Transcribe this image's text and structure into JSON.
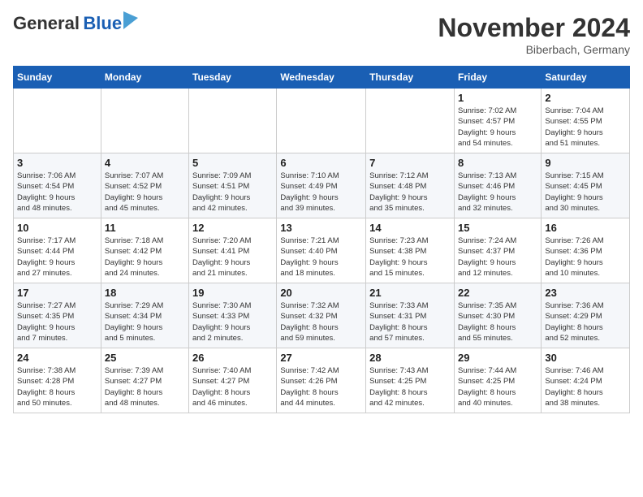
{
  "header": {
    "logo_line1": "General",
    "logo_line2": "Blue",
    "month": "November 2024",
    "location": "Biberbach, Germany"
  },
  "weekdays": [
    "Sunday",
    "Monday",
    "Tuesday",
    "Wednesday",
    "Thursday",
    "Friday",
    "Saturday"
  ],
  "weeks": [
    [
      {
        "day": "",
        "info": ""
      },
      {
        "day": "",
        "info": ""
      },
      {
        "day": "",
        "info": ""
      },
      {
        "day": "",
        "info": ""
      },
      {
        "day": "",
        "info": ""
      },
      {
        "day": "1",
        "info": "Sunrise: 7:02 AM\nSunset: 4:57 PM\nDaylight: 9 hours\nand 54 minutes."
      },
      {
        "day": "2",
        "info": "Sunrise: 7:04 AM\nSunset: 4:55 PM\nDaylight: 9 hours\nand 51 minutes."
      }
    ],
    [
      {
        "day": "3",
        "info": "Sunrise: 7:06 AM\nSunset: 4:54 PM\nDaylight: 9 hours\nand 48 minutes."
      },
      {
        "day": "4",
        "info": "Sunrise: 7:07 AM\nSunset: 4:52 PM\nDaylight: 9 hours\nand 45 minutes."
      },
      {
        "day": "5",
        "info": "Sunrise: 7:09 AM\nSunset: 4:51 PM\nDaylight: 9 hours\nand 42 minutes."
      },
      {
        "day": "6",
        "info": "Sunrise: 7:10 AM\nSunset: 4:49 PM\nDaylight: 9 hours\nand 39 minutes."
      },
      {
        "day": "7",
        "info": "Sunrise: 7:12 AM\nSunset: 4:48 PM\nDaylight: 9 hours\nand 35 minutes."
      },
      {
        "day": "8",
        "info": "Sunrise: 7:13 AM\nSunset: 4:46 PM\nDaylight: 9 hours\nand 32 minutes."
      },
      {
        "day": "9",
        "info": "Sunrise: 7:15 AM\nSunset: 4:45 PM\nDaylight: 9 hours\nand 30 minutes."
      }
    ],
    [
      {
        "day": "10",
        "info": "Sunrise: 7:17 AM\nSunset: 4:44 PM\nDaylight: 9 hours\nand 27 minutes."
      },
      {
        "day": "11",
        "info": "Sunrise: 7:18 AM\nSunset: 4:42 PM\nDaylight: 9 hours\nand 24 minutes."
      },
      {
        "day": "12",
        "info": "Sunrise: 7:20 AM\nSunset: 4:41 PM\nDaylight: 9 hours\nand 21 minutes."
      },
      {
        "day": "13",
        "info": "Sunrise: 7:21 AM\nSunset: 4:40 PM\nDaylight: 9 hours\nand 18 minutes."
      },
      {
        "day": "14",
        "info": "Sunrise: 7:23 AM\nSunset: 4:38 PM\nDaylight: 9 hours\nand 15 minutes."
      },
      {
        "day": "15",
        "info": "Sunrise: 7:24 AM\nSunset: 4:37 PM\nDaylight: 9 hours\nand 12 minutes."
      },
      {
        "day": "16",
        "info": "Sunrise: 7:26 AM\nSunset: 4:36 PM\nDaylight: 9 hours\nand 10 minutes."
      }
    ],
    [
      {
        "day": "17",
        "info": "Sunrise: 7:27 AM\nSunset: 4:35 PM\nDaylight: 9 hours\nand 7 minutes."
      },
      {
        "day": "18",
        "info": "Sunrise: 7:29 AM\nSunset: 4:34 PM\nDaylight: 9 hours\nand 5 minutes."
      },
      {
        "day": "19",
        "info": "Sunrise: 7:30 AM\nSunset: 4:33 PM\nDaylight: 9 hours\nand 2 minutes."
      },
      {
        "day": "20",
        "info": "Sunrise: 7:32 AM\nSunset: 4:32 PM\nDaylight: 8 hours\nand 59 minutes."
      },
      {
        "day": "21",
        "info": "Sunrise: 7:33 AM\nSunset: 4:31 PM\nDaylight: 8 hours\nand 57 minutes."
      },
      {
        "day": "22",
        "info": "Sunrise: 7:35 AM\nSunset: 4:30 PM\nDaylight: 8 hours\nand 55 minutes."
      },
      {
        "day": "23",
        "info": "Sunrise: 7:36 AM\nSunset: 4:29 PM\nDaylight: 8 hours\nand 52 minutes."
      }
    ],
    [
      {
        "day": "24",
        "info": "Sunrise: 7:38 AM\nSunset: 4:28 PM\nDaylight: 8 hours\nand 50 minutes."
      },
      {
        "day": "25",
        "info": "Sunrise: 7:39 AM\nSunset: 4:27 PM\nDaylight: 8 hours\nand 48 minutes."
      },
      {
        "day": "26",
        "info": "Sunrise: 7:40 AM\nSunset: 4:27 PM\nDaylight: 8 hours\nand 46 minutes."
      },
      {
        "day": "27",
        "info": "Sunrise: 7:42 AM\nSunset: 4:26 PM\nDaylight: 8 hours\nand 44 minutes."
      },
      {
        "day": "28",
        "info": "Sunrise: 7:43 AM\nSunset: 4:25 PM\nDaylight: 8 hours\nand 42 minutes."
      },
      {
        "day": "29",
        "info": "Sunrise: 7:44 AM\nSunset: 4:25 PM\nDaylight: 8 hours\nand 40 minutes."
      },
      {
        "day": "30",
        "info": "Sunrise: 7:46 AM\nSunset: 4:24 PM\nDaylight: 8 hours\nand 38 minutes."
      }
    ]
  ]
}
